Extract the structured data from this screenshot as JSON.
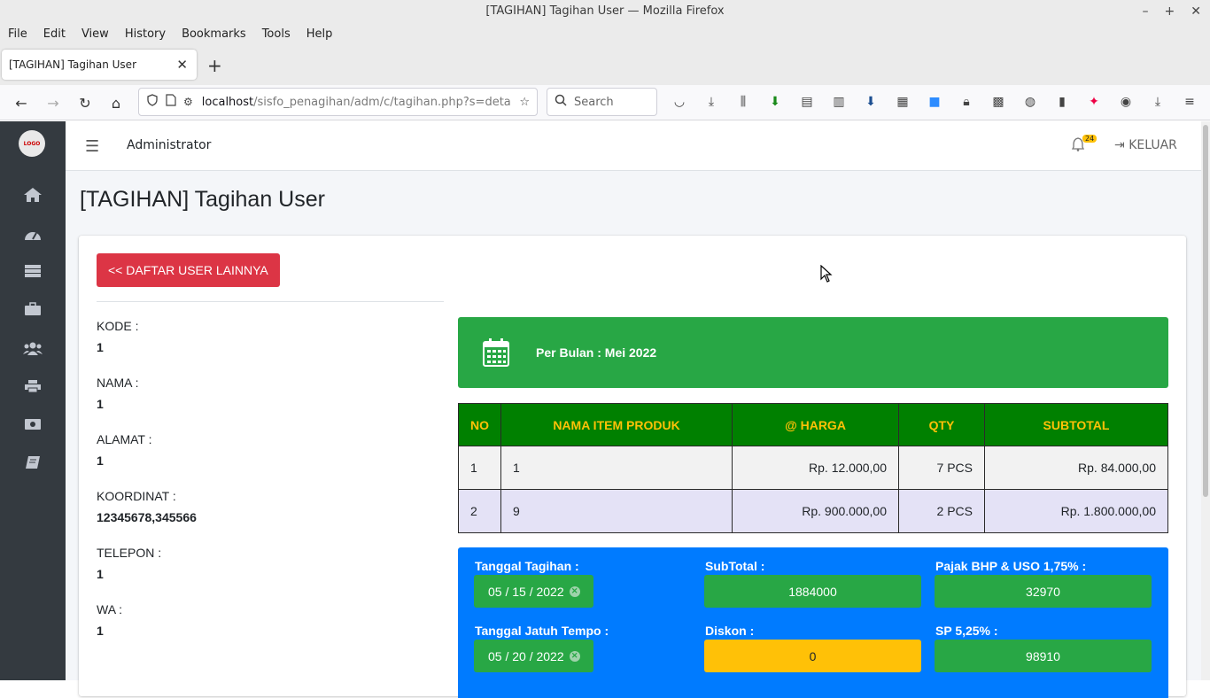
{
  "browser": {
    "window_title": "[TAGIHAN] Tagihan User — Mozilla Firefox",
    "menu": [
      "File",
      "Edit",
      "View",
      "History",
      "Bookmarks",
      "Tools",
      "Help"
    ],
    "tab_title": "[TAGIHAN] Tagihan User",
    "url_host": "localhost",
    "url_path": "/sisfo_penagihan/adm/c/tagihan.php?s=deta",
    "search_placeholder": "Search"
  },
  "topnav": {
    "user": "Administrator",
    "notif_count": "24",
    "logout_label": "KELUAR"
  },
  "page": {
    "title": "[TAGIHAN] Tagihan User",
    "back_button": "<< DAFTAR USER LAINNYA"
  },
  "customer": {
    "kode_label": "KODE :",
    "kode": "1",
    "nama_label": "NAMA :",
    "nama": "1",
    "alamat_label": "ALAMAT :",
    "alamat": "1",
    "koordinat_label": "KOORDINAT :",
    "koordinat": "12345678,345566",
    "telepon_label": "TELEPON :",
    "telepon": "1",
    "wa_label": "WA :",
    "wa": "1"
  },
  "period": {
    "text": "Per Bulan : Mei 2022"
  },
  "items_table": {
    "headers": [
      "NO",
      "NAMA ITEM PRODUK",
      "@ HARGA",
      "QTY",
      "SUBTOTAL"
    ],
    "rows": [
      [
        "1",
        "1",
        "Rp. 12.000,00",
        "7 PCS",
        "Rp. 84.000,00"
      ],
      [
        "2",
        "9",
        "Rp. 900.000,00",
        "2 PCS",
        "Rp. 1.800.000,00"
      ]
    ]
  },
  "summary": {
    "tanggal_tagihan_label": "Tanggal Tagihan :",
    "tanggal_tagihan": "05 / 15 / 2022",
    "tanggal_jatuh_tempo_label": "Tanggal Jatuh Tempo :",
    "tanggal_jatuh_tempo": "05 / 20 / 2022",
    "subtotal_label": "SubTotal :",
    "subtotal": "1884000",
    "diskon_label": "Diskon :",
    "diskon": "0",
    "pajak_label": "Pajak BHP & USO 1,75% :",
    "pajak": "32970",
    "sp_label": "SP 5,25% :",
    "sp": "98910"
  },
  "colors": {
    "sidebar": "#343a40",
    "danger": "#dc3545",
    "success": "#28a745",
    "table_header": "#008000",
    "table_header_text": "#ffc107",
    "primary": "#007bff",
    "warning": "#ffc107"
  }
}
